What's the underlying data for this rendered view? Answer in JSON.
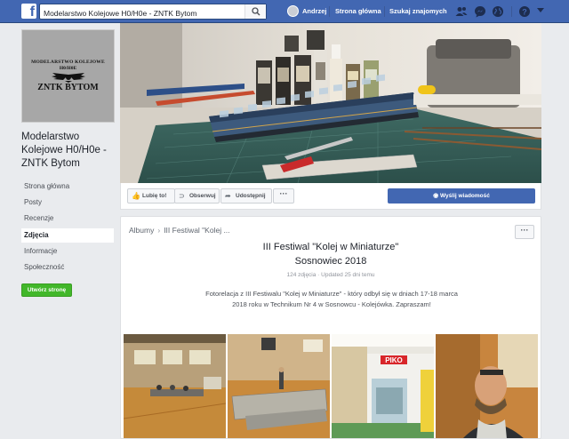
{
  "topbar": {
    "search_value": "Modelarstwo Kolejowe H0/H0e - ZNTK Bytom",
    "user_name": "Andrzej",
    "home_label": "Strona główna",
    "find_friends_label": "Szukaj znajomych",
    "help_label": "?",
    "colors": {
      "bar": "#4267b2",
      "accent_green": "#42b72a"
    }
  },
  "page": {
    "logo_line1": "MODELARSTWO KOLEJOWE",
    "logo_line2": "H0/H0E",
    "logo_line3": "ZNTK BYTOM",
    "name_line1": "Modelarstwo",
    "name_line2": "Kolejowe H0/H0e -",
    "name_line3": "ZNTK Bytom"
  },
  "sidebar": {
    "items": [
      {
        "label": "Strona główna"
      },
      {
        "label": "Posty"
      },
      {
        "label": "Recenzje"
      },
      {
        "label": "Zdjęcia"
      },
      {
        "label": "Informacje"
      },
      {
        "label": "Społeczność"
      }
    ],
    "create_page_label": "Utwórz stronę"
  },
  "actions": {
    "like_label": "Lubię to!",
    "follow_label": "Obserwuj",
    "share_label": "Udostępnij",
    "more_label": "···",
    "message_label": "Wyślij wiadomość"
  },
  "album": {
    "crumb_albums": "Albumy",
    "crumb_current": "III Festiwal \"Kolej ...",
    "more_label": "···",
    "title_line1": "III Festiwal \"Kolej w Miniaturze\"",
    "title_line2": "Sosnowiec 2018",
    "meta": "124 zdjęcia · Updated 25 dni temu",
    "desc_line1": "Fotorelacja z III Festiwalu \"Kolej w Miniaturze\" - który odbył się w dniach 17-18 marca",
    "desc_line2": "2018 roku w Technikum Nr 4 w Sosnowcu - Kolejówka. Zapraszam!",
    "photo_sign": "PIKO"
  }
}
